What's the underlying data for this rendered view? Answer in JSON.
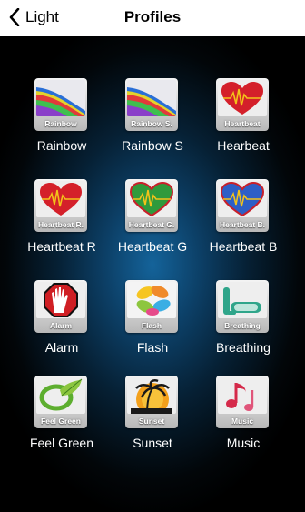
{
  "nav": {
    "back_label": "Light",
    "title": "Profiles"
  },
  "profiles": [
    {
      "caption": "Rainbow",
      "label": "Rainbow",
      "icon": "rainbow-icon"
    },
    {
      "caption": "Rainbow S.",
      "label": "Rainbow S",
      "icon": "rainbow-icon"
    },
    {
      "caption": "Heartbeat",
      "label": "Hearbeat",
      "icon": "heartbeat-icon"
    },
    {
      "caption": "Heartbeat R.",
      "label": "Heartbeat R",
      "icon": "heartbeat-red-icon"
    },
    {
      "caption": "Heartbeat G.",
      "label": "Heartbeat G",
      "icon": "heartbeat-green-icon"
    },
    {
      "caption": "Heartbeat B.",
      "label": "Heartbeat B",
      "icon": "heartbeat-blue-icon"
    },
    {
      "caption": "Alarm",
      "label": "Alarm",
      "icon": "hand-stop-icon"
    },
    {
      "caption": "Flash",
      "label": "Flash",
      "icon": "flash-petals-icon"
    },
    {
      "caption": "Breathing",
      "label": "Breathing",
      "icon": "snorkel-mask-icon"
    },
    {
      "caption": "Feel Green",
      "label": "Feel Green",
      "icon": "green-swirl-icon"
    },
    {
      "caption": "Sunset",
      "label": "Sunset",
      "icon": "palm-sunset-icon"
    },
    {
      "caption": "Music",
      "label": "Music",
      "icon": "music-note-icon"
    }
  ]
}
